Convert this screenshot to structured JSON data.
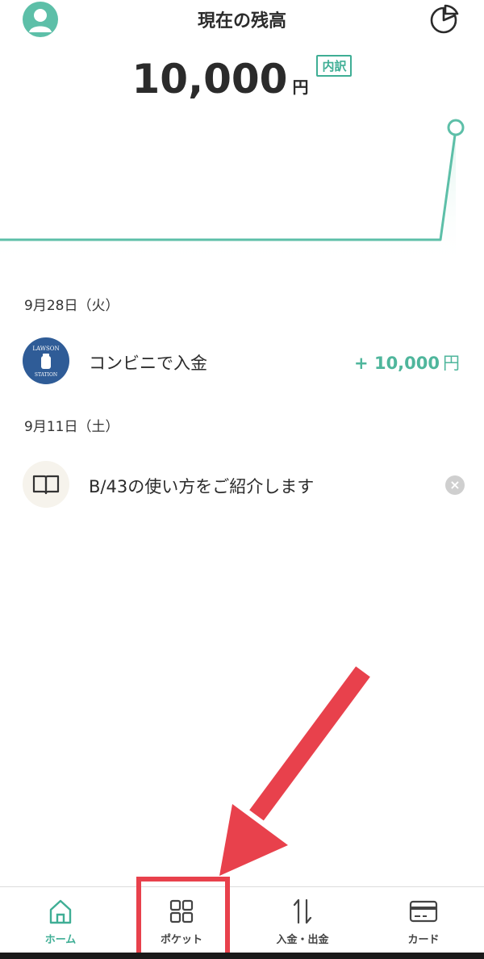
{
  "header": {
    "title": "現在の残高",
    "avatar_icon": "user-avatar-icon",
    "chart_icon": "pie-chart-icon"
  },
  "balance": {
    "amount": "10,000",
    "unit": "円",
    "breakdown_label": "内訳"
  },
  "colors": {
    "accent": "#3fae95",
    "highlight": "#e8414c"
  },
  "transactions": [
    {
      "date": "9月28日（火）",
      "label": "コンビニで入金",
      "amount": "+ 10,000",
      "unit": "円",
      "icon": "lawson-station-icon",
      "icon_text_top": "LAWSON",
      "icon_text_bottom": "STATION"
    },
    {
      "date": "9月11日（土）",
      "label": "B/43の使い方をご紹介します",
      "icon": "book-icon"
    }
  ],
  "nav": {
    "items": [
      {
        "label": "ホーム",
        "icon": "home-icon",
        "active": true
      },
      {
        "label": "ポケット",
        "icon": "grid-icon",
        "active": false
      },
      {
        "label": "入金・出金",
        "icon": "transfer-arrows-icon",
        "active": false
      },
      {
        "label": "カード",
        "icon": "card-icon",
        "active": false
      }
    ]
  }
}
